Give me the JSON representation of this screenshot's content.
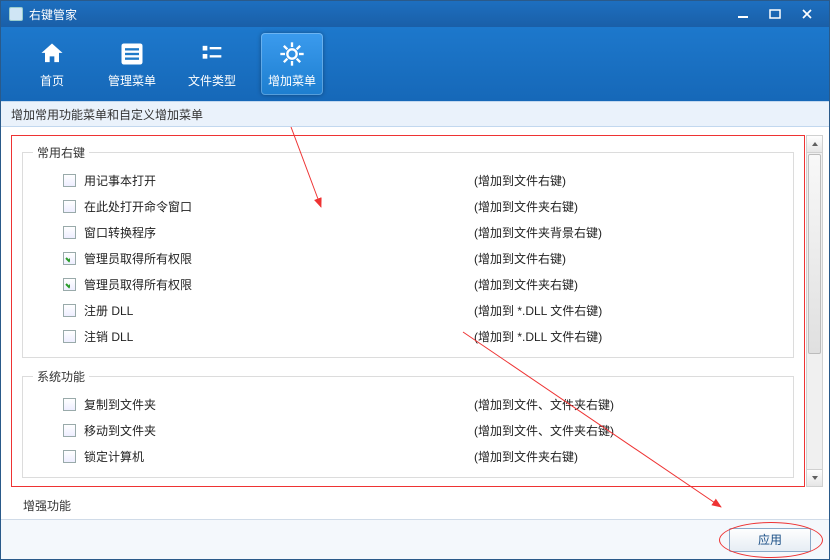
{
  "window": {
    "title": "右键管家"
  },
  "toolbar": {
    "home": "首页",
    "manage": "管理菜单",
    "filetype": "文件类型",
    "addmenu": "增加菜单"
  },
  "subtitle": "增加常用功能菜单和自定义增加菜单",
  "groups": {
    "common": {
      "legend": "常用右键",
      "items": [
        {
          "name": "用记事本打开",
          "desc": "(增加到文件右键)",
          "checked": false
        },
        {
          "name": "在此处打开命令窗口",
          "desc": "(增加到文件夹右键)",
          "checked": false
        },
        {
          "name": "窗口转换程序",
          "desc": "(增加到文件夹背景右键)",
          "checked": false
        },
        {
          "name": "管理员取得所有权限",
          "desc": "(增加到文件右键)",
          "checked": true
        },
        {
          "name": "管理员取得所有权限",
          "desc": "(增加到文件夹右键)",
          "checked": true
        },
        {
          "name": "注册 DLL",
          "desc": "(增加到 *.DLL 文件右键)",
          "checked": false
        },
        {
          "name": "注销 DLL",
          "desc": "(增加到 *.DLL 文件右键)",
          "checked": false
        }
      ]
    },
    "system": {
      "legend": "系统功能",
      "items": [
        {
          "name": "复制到文件夹",
          "desc": "(增加到文件、文件夹右键)",
          "checked": false
        },
        {
          "name": "移动到文件夹",
          "desc": "(增加到文件、文件夹右键)",
          "checked": false
        },
        {
          "name": "锁定计算机",
          "desc": "(增加到文件夹右键)",
          "checked": false
        }
      ]
    },
    "enhance": {
      "legend": "增强功能"
    }
  },
  "apply": "应用"
}
